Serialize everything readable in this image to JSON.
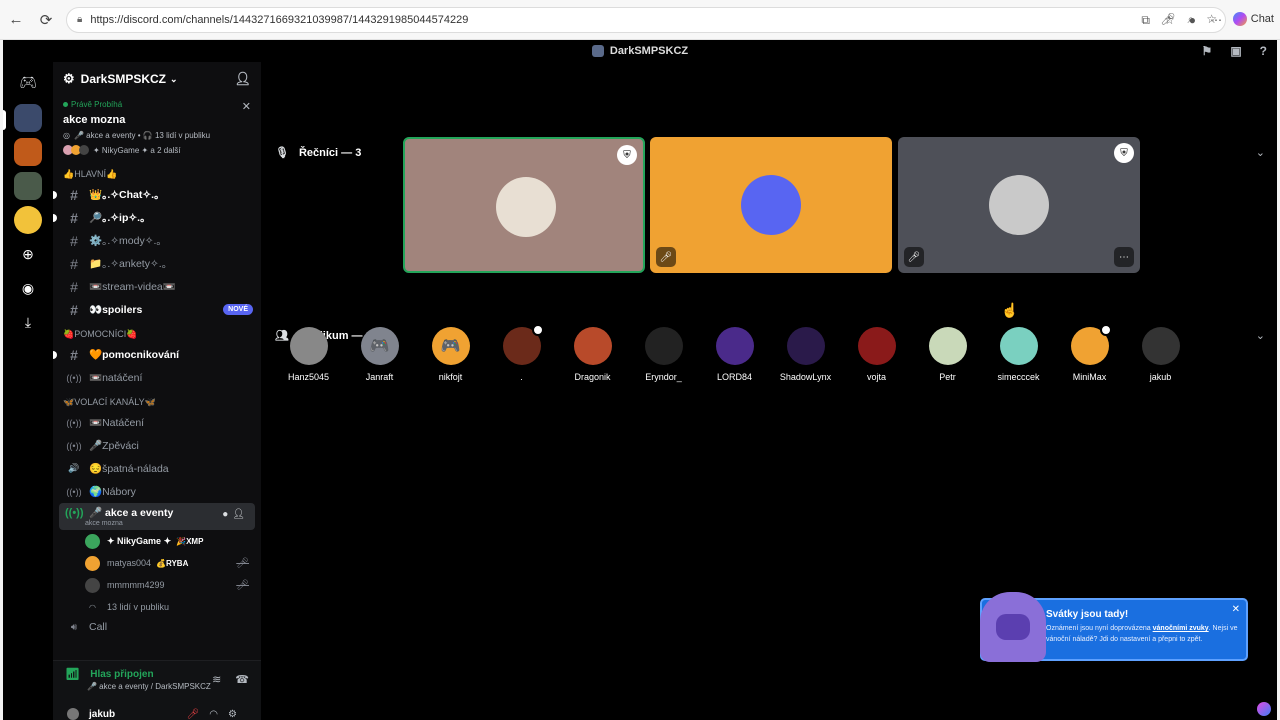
{
  "browser": {
    "url": "https://discord.com/channels/1443271669321039987/1443291985044574229",
    "chat_label": "Chat"
  },
  "window": {
    "title": "DarkSMPSKCZ"
  },
  "server": {
    "name": "DarkSMPSKCZ",
    "event": {
      "status": "Právě Probíhá",
      "title": "akce mozna",
      "meta": "🎤 akce a eventy • 🎧 13 lidí v publiku",
      "attendees": "✦ NikyGame ✦ a 2 další"
    },
    "categories": [
      {
        "label": "👍HLAVNÍ👍",
        "channels": [
          {
            "name": "👑｡.✧Chat✧.｡",
            "icon": "#",
            "bold": true,
            "unread": true
          },
          {
            "name": "🔎｡.✧ip✧.｡",
            "icon": "#",
            "bold": true,
            "unread": true
          },
          {
            "name": "⚙️｡.✧mody✧.｡",
            "icon": "#",
            "bold": false
          },
          {
            "name": "📁｡.✧ankety✧.｡",
            "icon": "#",
            "bold": false
          },
          {
            "name": "📼stream-videa📼",
            "icon": "#",
            "bold": false
          },
          {
            "name": "👀spoilers",
            "icon": "#",
            "bold": true,
            "badge": "NOVÉ"
          }
        ]
      },
      {
        "label": "🍓POMOCNÍCI🍓",
        "channels": [
          {
            "name": "🧡pomocnikování",
            "icon": "#",
            "bold": true,
            "unread": true
          },
          {
            "name": "📼natáčení",
            "icon": "((•))",
            "bold": false
          }
        ]
      },
      {
        "label": "🦋VOLACÍ KANÁLY🦋",
        "channels": [
          {
            "name": "📼Natáčení",
            "icon": "((•))",
            "bold": false
          },
          {
            "name": "🎤Zpěváci",
            "icon": "((•))",
            "bold": false
          },
          {
            "name": "😔špatná-nálada",
            "icon": "🔊",
            "bold": false
          },
          {
            "name": "🌍Nábory",
            "icon": "((•))",
            "bold": false
          }
        ]
      }
    ],
    "active_channel": {
      "name": "🎤 akce a eventy",
      "sub": "akce mozna"
    },
    "voice_users": [
      {
        "name": "✦ NikyGame ✦",
        "tag": "🎉XMP",
        "bold": true,
        "color": "#3ba55d"
      },
      {
        "name": "matyas004",
        "tag": "💰RYBA",
        "bold": false,
        "color": "#f0a232",
        "muted": true
      },
      {
        "name": "mmmmm4299",
        "tag": "",
        "bold": false,
        "color": "#444444",
        "muted": true
      },
      {
        "name": "13 lidí v publiku",
        "tag": "",
        "bold": false,
        "color": ""
      }
    ],
    "next_channel": "Call"
  },
  "voice_panel": {
    "status": "Hlas připojen",
    "location": "🎤 akce a eventy / DarkSMPSKCZ",
    "username": "jakub"
  },
  "stage": {
    "speakers_label": "Řečníci — 3",
    "audience_label": "Publikum — 13",
    "speaker_tiles": [
      {
        "bg": "#a1847c",
        "av": "#e8dfd3",
        "shield": true,
        "mute": false,
        "highlight": true
      },
      {
        "bg": "#f0a232",
        "av": "#5865f2",
        "shield": false,
        "mute": true,
        "highlight": false
      },
      {
        "bg": "#4e5058",
        "av": "#c9c9c9",
        "shield": true,
        "mute": true,
        "more": true,
        "highlight": false
      }
    ],
    "audience": [
      {
        "name": "Hanz5045",
        "color": "#888888"
      },
      {
        "name": "Janraft",
        "color": "#80848e",
        "glyph": "🎮"
      },
      {
        "name": "nikfojt",
        "color": "#f0a232",
        "glyph": "🎮"
      },
      {
        "name": ".",
        "color": "#6b2a1a",
        "mod": true
      },
      {
        "name": "Dragonik",
        "color": "#b84a2a"
      },
      {
        "name": "Eryndor_",
        "color": "#222222"
      },
      {
        "name": "LORD84",
        "color": "#4a2a8a"
      },
      {
        "name": "ShadowLynx",
        "color": "#2a1a4a"
      },
      {
        "name": "vojta",
        "color": "#8a1a1a"
      },
      {
        "name": "Petr",
        "color": "#c9d9b9"
      },
      {
        "name": "simecccek",
        "color": "#7ad0c0"
      },
      {
        "name": "MiniMax",
        "color": "#f0a232",
        "mod": true
      },
      {
        "name": "jakub",
        "color": "#333333"
      }
    ]
  },
  "toast": {
    "title": "Svátky jsou tady!",
    "body_1": "Oznámení jsou nyní doprovázena",
    "link": "vánočními zvuky",
    "body_2": ". Nejsi ve vánoční náladě? Jdi do nastavení a přepni to zpět."
  }
}
